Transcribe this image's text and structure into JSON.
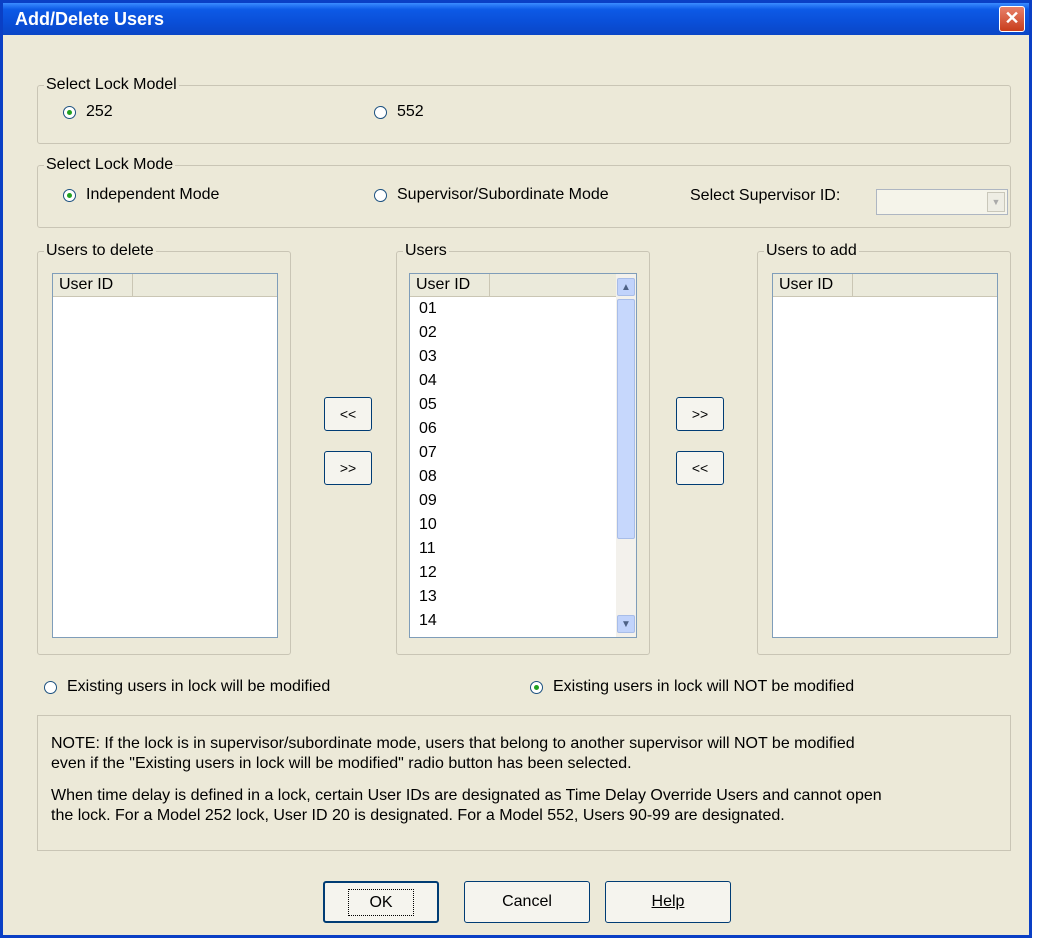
{
  "window": {
    "title": "Add/Delete Users",
    "close_glyph": "✕"
  },
  "lock_model": {
    "legend": "Select Lock Model",
    "options": [
      "252",
      "552"
    ],
    "selected": "252"
  },
  "lock_mode": {
    "legend": "Select Lock Mode",
    "options": [
      "Independent Mode",
      "Supervisor/Subordinate Mode"
    ],
    "selected": "Independent Mode",
    "supervisor_label": "Select Supervisor ID:",
    "supervisor_value": ""
  },
  "users_to_delete": {
    "legend": "Users to delete",
    "column": "User ID",
    "rows": []
  },
  "users": {
    "legend": "Users",
    "column": "User ID",
    "rows": [
      "01",
      "02",
      "03",
      "04",
      "05",
      "06",
      "07",
      "08",
      "09",
      "10",
      "11",
      "12",
      "13",
      "14"
    ]
  },
  "users_to_add": {
    "legend": "Users to add",
    "column": "User ID",
    "rows": []
  },
  "transfer_buttons": {
    "left_top": "<<",
    "left_bottom": ">>",
    "right_top": ">>",
    "right_bottom": "<<"
  },
  "modify_option": {
    "options": [
      "Existing users in lock will be modified",
      "Existing users in lock will NOT be modified"
    ],
    "selected": "Existing users in lock will NOT be modified"
  },
  "note": {
    "line1": "NOTE: If the lock is in supervisor/subordinate mode, users that belong to another supervisor will NOT be modified",
    "line2": "even if the \"Existing users in lock will be modified\" radio button has been selected.",
    "line3": "When time delay is defined in a lock, certain User IDs are designated as Time Delay Override Users and cannot open",
    "line4": "the lock. For a Model 252 lock, User ID 20 is designated. For a Model 552, Users 90-99 are designated."
  },
  "buttons": {
    "ok": "OK",
    "cancel": "Cancel",
    "help": "Help"
  },
  "icons": {
    "scroll_up": "scroll-up-arrow-icon",
    "scroll_down": "scroll-down-arrow-icon",
    "combo_drop": "chevron-down-icon"
  },
  "colors": {
    "titlebar": "#0a4fd8",
    "dialog_bg": "#ece9d8",
    "radio_dot": "#21a121",
    "close_button": "#c83d1b"
  }
}
